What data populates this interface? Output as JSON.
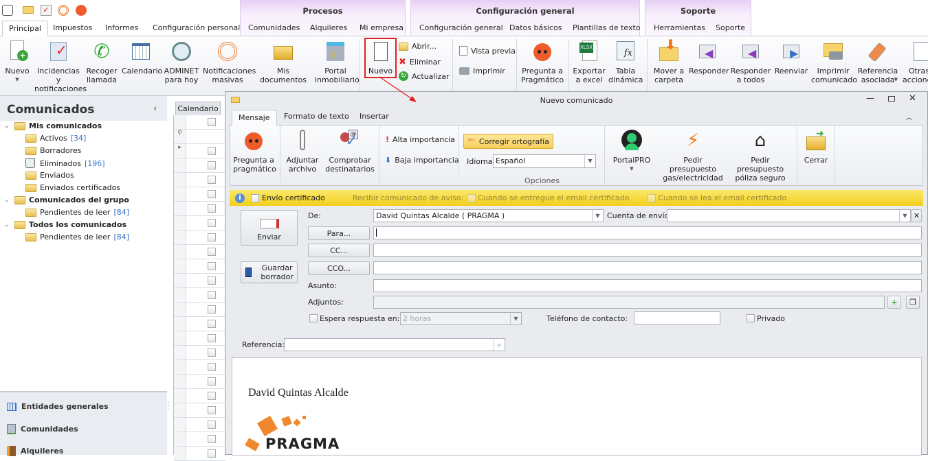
{
  "quick_access": {
    "icons": [
      "app-icon",
      "mail-icon",
      "tasks-icon",
      "broadcast-icon",
      "pragmatico-icon"
    ]
  },
  "context_groups": [
    {
      "title": "Procesos"
    },
    {
      "title": "Configuración general"
    },
    {
      "title": "Soporte"
    }
  ],
  "tabs": [
    "Principal",
    "Impuestos",
    "Informes",
    "Configuración personal",
    "Comunidades",
    "Alquileres",
    "Mi empresa",
    "Configuración general",
    "Datos básicos",
    "Plantillas de texto",
    "Herramientas",
    "Soporte"
  ],
  "active_tab": "Principal",
  "ribbon": {
    "nuevo": "Nuevo",
    "incidencias": "Incidencias y notificaciones",
    "recoger": "Recoger llamada",
    "calendario": "Calendario",
    "adminet": "ADMINET para hoy",
    "notificaciones": "Notificaciones masivas",
    "documentos": "Mis documentos",
    "portal": "Portal inmobiliario",
    "nuevo_com": "Nuevo",
    "abrir": "Abrir...",
    "eliminar": "Eliminar",
    "actualizar": "Actualizar",
    "vista_previa": "Vista previa",
    "imprimir": "Imprimir",
    "pregunta": "Pregunta a Pragmático",
    "exportar": "Exportar a excel",
    "tabla": "Tabla dinámica",
    "mover": "Mover a carpeta",
    "responder": "Responder",
    "responder_todos": "Responder a todos",
    "reenviar": "Reenviar",
    "imprimir_com": "Imprimir comunicado",
    "referencia": "Referencia asociada",
    "otras": "Otras acciones"
  },
  "highlight_color": "#e02020",
  "sidebar": {
    "title": "Comunicados",
    "tree": [
      {
        "label": "Mis comunicados",
        "count": ""
      },
      {
        "label": "Activos",
        "count": "[34]"
      },
      {
        "label": "Borradores",
        "count": ""
      },
      {
        "label": "Eliminados",
        "count": "[196]"
      },
      {
        "label": "Enviados",
        "count": ""
      },
      {
        "label": "Enviados certificados",
        "count": ""
      },
      {
        "label": "Comunicados del grupo",
        "count": ""
      },
      {
        "label": "Pendientes de leer",
        "count": "[84]"
      },
      {
        "label": "Todos los comunicados",
        "count": ""
      },
      {
        "label": "Pendientes de leer",
        "count": "[84]"
      }
    ],
    "nav": [
      "Entidades generales",
      "Comunidades",
      "Alquileres"
    ]
  },
  "grid": {
    "tab": "Calendario"
  },
  "dialog": {
    "title": "Nuevo comunicado",
    "tabs": [
      "Mensaje",
      "Formato de texto",
      "Insertar"
    ],
    "ribbon": {
      "pregunta": "Pregunta a pragmático",
      "adjuntar": "Adjuntar archivo",
      "comprobar": "Comprobar destinatarios",
      "alta": "Alta importancia",
      "baja": "Baja importancia",
      "corregir": "Corregir ortografía",
      "idioma_label": "Idioma:",
      "idioma_value": "Español",
      "opciones": "Opciones",
      "portalpro": "PortalPRO",
      "gas": "Pedir presupuesto gas/electricidad",
      "poliza": "Pedir presupuesto póliza seguro",
      "cerrar": "Cerrar"
    },
    "infobar": {
      "certificado": "Envío certificado",
      "recibir": "Recibir comunicado de aviso:",
      "entregue": "Cuando se entregue el email certificado",
      "lea": "Cuando se lea el email certificado"
    },
    "form": {
      "enviar": "Enviar",
      "guardar": "Guardar borrador",
      "de_label": "De:",
      "de_value": "David Quintas Alcalde ( PRAGMA )",
      "cuenta_label": "Cuenta de envío:",
      "cuenta_value": "",
      "para": "Para...",
      "cc": "CC...",
      "cco": "CCO...",
      "asunto_label": "Asunto:",
      "adjuntos_label": "Adjuntos:",
      "espera_label": "Espera respuesta en:",
      "espera_value": "2 horas",
      "telefono_label": "Teléfono de contacto:",
      "privado": "Privado",
      "referencia_label": "Referencia:"
    },
    "body": {
      "signature": "David Quintas Alcalde",
      "logo_text": "PRAGMA"
    }
  }
}
